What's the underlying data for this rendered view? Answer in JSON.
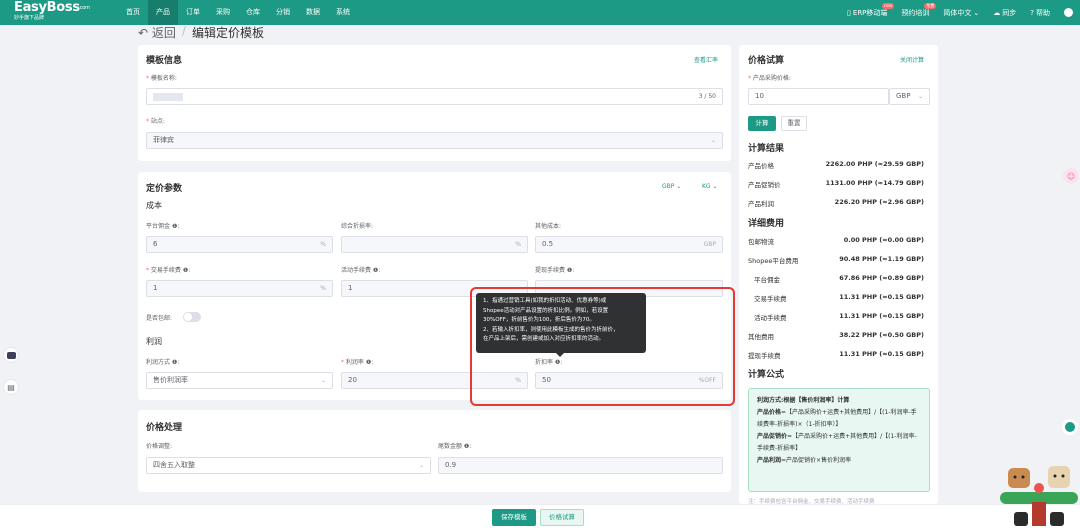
{
  "nav": {
    "logo": "EasyBoss",
    "logo_sup": "com",
    "slogan": "妙手旗下品牌",
    "menu": [
      "首页",
      "产品",
      "订单",
      "采购",
      "仓库",
      "分销",
      "数据",
      "系统"
    ],
    "active_index": 1,
    "right": {
      "erp": "ERP移动端",
      "erp_badge": "new",
      "appointment": "预约培训",
      "appointment_badge": "免费",
      "language": "简体中文",
      "sync": "同步",
      "help": "帮助"
    }
  },
  "breadcrumb": {
    "back": "返回",
    "title": "编辑定价模板"
  },
  "template_info": {
    "title": "模板信息",
    "view_rate": "查看汇率",
    "name_label": "模板名称:",
    "name_count": "3 / 50",
    "site_label": "站点:",
    "site_value": "菲律宾"
  },
  "pricing": {
    "title": "定价参数",
    "currency": "GBP",
    "weight_unit": "KG",
    "cost_title": "成本",
    "platform_fee_label": "平台佣金",
    "platform_fee_value": "6",
    "platform_fee_unit": "%",
    "discount_rate_label": "综合折损率:",
    "discount_rate_unit": "%",
    "other_cost_label": "其他成本:",
    "other_cost_value": "0.5",
    "other_cost_unit": "GBP",
    "trade_fee_label": "交易手续费",
    "trade_fee_value": "1",
    "trade_fee_unit": "%",
    "activity_fee_label": "活动手续费",
    "activity_fee_value": "1",
    "withdraw_fee_label": "提现手续费",
    "free_shipping_label": "是否包邮:",
    "profit_title": "利润",
    "profit_method_label": "利润方式",
    "profit_method_value": "售价利润率",
    "profit_rate_label": "利润率",
    "profit_rate_value": "20",
    "profit_rate_unit": "%",
    "discount_label": "折扣率",
    "discount_value": "50",
    "discount_unit": "%OFF",
    "tooltip": [
      "1、指通过营销工具(如我的折扣活动、优惠券等)或",
      "Shopee活动对产品设置的折扣比例。例如，若设置",
      "30%OFF，折前售价为100，折后售价为70。",
      "2、若输入折扣率，则使用此模板生成的售价为折前价，",
      "在产品上架后，需创建或加入对应折扣率的活动。"
    ]
  },
  "price_processing": {
    "title": "价格处理",
    "adjust_label": "价格调整:",
    "adjust_value": "四舍五入取整",
    "tail_label": "尾数金额",
    "tail_value": "0.9"
  },
  "trial": {
    "title": "价格试算",
    "close": "关闭计算",
    "purchase_label": "产品采购价格:",
    "purchase_value": "10",
    "purchase_currency": "GBP",
    "calc": "计算",
    "reset": "重置",
    "result_title": "计算结果",
    "results": [
      {
        "label": "产品价格",
        "value": "2262.00 PHP (≈29.59 GBP)"
      },
      {
        "label": "产品促销价",
        "value": "1131.00 PHP (≈14.79 GBP)"
      },
      {
        "label": "产品利润",
        "value": "226.20 PHP (≈2.96 GBP)"
      }
    ],
    "detail_title": "详细费用",
    "details": [
      {
        "label": "包邮物流",
        "value": "0.00 PHP (≈0.00 GBP)",
        "indent": false
      },
      {
        "label": "Shopee平台费用",
        "value": "90.48 PHP (≈1.19 GBP)",
        "indent": false
      },
      {
        "label": "平台佣金",
        "value": "67.86 PHP (≈0.89 GBP)",
        "indent": true
      },
      {
        "label": "交易手续费",
        "value": "11.31 PHP (≈0.15 GBP)",
        "indent": true
      },
      {
        "label": "活动手续费",
        "value": "11.31 PHP (≈0.15 GBP)",
        "indent": true
      },
      {
        "label": "其他费用",
        "value": "38.22 PHP (≈0.50 GBP)",
        "indent": false
      },
      {
        "label": "提现手续费",
        "value": "11.31 PHP (≈0.15 GBP)",
        "indent": false
      }
    ],
    "formula_title": "计算公式",
    "formula_method": "利润方式:根据【售价利润率】计算",
    "formula_price_key": "产品价格",
    "formula_price": "=【产品采购价+运费+其他费用】/【(1-利润率-手续费率-折损率)×（1-折扣率）】",
    "formula_promo_key": "产品促销价",
    "formula_promo": "=【产品采购价+运费+其他费用】/【(1-利润率-手续费-折损率】",
    "formula_profit_key": "产品利润",
    "formula_profit": "=产品促销价×售价利润率",
    "note": "注：手续费包含平台佣金、交易手续费、活动手续费"
  },
  "footer": {
    "save": "保存模板",
    "trial": "价格试算"
  },
  "colors": {
    "brand": "#1d9a85",
    "highlight": "#e53935"
  }
}
